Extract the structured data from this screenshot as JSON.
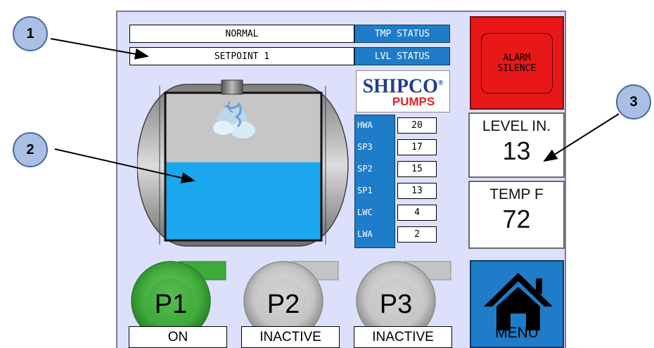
{
  "status_rows": [
    {
      "value": "NORMAL",
      "tag": "TMP STATUS"
    },
    {
      "value": "SETPOINT 1",
      "tag": "LVL STATUS"
    }
  ],
  "alarm_button": {
    "line1": "ALARM",
    "line2": "SILENCE",
    "color": "#e81818"
  },
  "logo": {
    "line1": "SHIPCO",
    "line2": "PUMPS",
    "registered": "®"
  },
  "setpoints": [
    {
      "label": "HWA",
      "value": "20"
    },
    {
      "label": "SP3",
      "value": "17"
    },
    {
      "label": "SP2",
      "value": "15"
    },
    {
      "label": "SP1",
      "value": "13"
    },
    {
      "label": "LWC",
      "value": "4"
    },
    {
      "label": "LWA",
      "value": "2"
    }
  ],
  "level": {
    "label": "LEVEL IN.",
    "value": "13"
  },
  "temp": {
    "label": "TEMP F",
    "value": "72"
  },
  "tank": {
    "fill_fraction": 0.53,
    "water_color": "#1aa7ee"
  },
  "pumps": [
    {
      "name": "P1",
      "status": "ON",
      "color": "#3daa3a"
    },
    {
      "name": "P2",
      "status": "INACTIVE",
      "color": "#c4c4c4"
    },
    {
      "name": "P3",
      "status": "INACTIVE",
      "color": "#c4c4c4"
    }
  ],
  "menu_button": {
    "label": "MENU",
    "icon": "home-icon",
    "color": "#1e7cc8"
  },
  "callouts": [
    "1",
    "2",
    "3"
  ]
}
